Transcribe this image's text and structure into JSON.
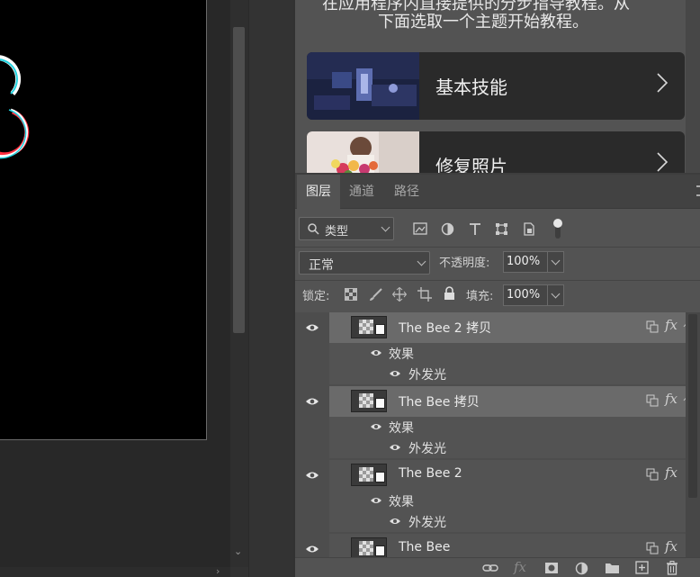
{
  "learn": {
    "intro_line1": "在应用程序内直接提供的分步指导教程。从",
    "intro_line2": "下面选取一个主题开始教程。",
    "cards": [
      {
        "label": "基本技能"
      },
      {
        "label": "修复照片"
      }
    ]
  },
  "layers_panel": {
    "tabs": [
      {
        "label": "图层",
        "active": true
      },
      {
        "label": "通道",
        "active": false
      },
      {
        "label": "路径",
        "active": false
      }
    ],
    "filter": {
      "label": "类型"
    },
    "blend_mode": "正常",
    "opacity_label": "不透明度:",
    "opacity_value": "100%",
    "lock_label": "锁定:",
    "fill_label": "填充:",
    "fill_value": "100%",
    "layers": [
      {
        "name": "The Bee 2 拷贝",
        "selected": true,
        "effects_label": "效果",
        "effect": "外发光"
      },
      {
        "name": "The Bee 拷贝",
        "selected": true,
        "effects_label": "效果",
        "effect": "外发光"
      },
      {
        "name": "The Bee 2",
        "selected": false,
        "effects_label": "效果",
        "effect": "外发光"
      },
      {
        "name": "The Bee",
        "selected": false
      }
    ],
    "fx_symbol": "fx"
  },
  "colors": {
    "panel_bg": "#535353",
    "selected_row": "#6a6a6a",
    "canvas_bg": "#000000"
  }
}
